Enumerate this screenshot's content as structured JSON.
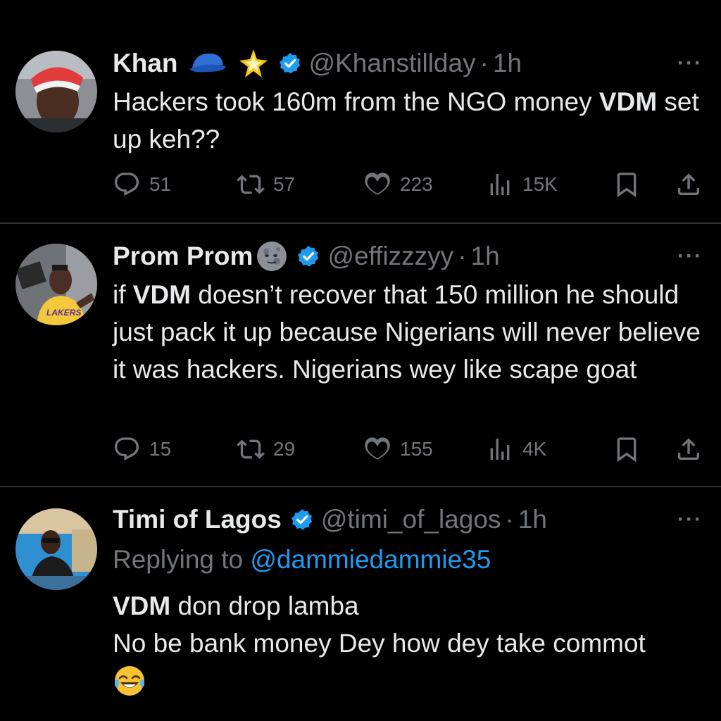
{
  "tweets": [
    {
      "name": "Khan",
      "handle": "@Khanstillday",
      "sep": "·",
      "time": "1h",
      "body_parts": [
        "Hackers took 160m from the NGO money ",
        "VDM",
        " set up keh??"
      ],
      "replies": "51",
      "retweets": "57",
      "likes": "223",
      "views": "15K"
    },
    {
      "name": "Prom Prom",
      "handle": "@effizzzyy",
      "sep": "·",
      "time": "1h",
      "body_parts": [
        "if ",
        "VDM",
        " doesn’t recover that 150 million he should just pack it up because Nigerians will never believe it was hackers. Nigerians wey like scape goat"
      ],
      "replies": "15",
      "retweets": "29",
      "likes": "155",
      "views": "4K"
    },
    {
      "name": "Timi of Lagos",
      "handle": "@timi_of_lagos",
      "sep": "·",
      "time": "1h",
      "replying_label": "Replying to ",
      "replying_handle": "@dammiedammie35",
      "line1_bold": "VDM",
      "line1_rest": " don drop lamba",
      "line2": "No be bank money Dey how dey take commot",
      "line3_emoji": "😂"
    }
  ],
  "more_label": "···",
  "colors": {
    "accent": "#1d9bf0",
    "muted": "#71767b",
    "text": "#e7e9ea",
    "background": "#000000",
    "divider": "#2f3336"
  },
  "icons": [
    "reply-icon",
    "retweet-icon",
    "like-icon",
    "views-icon",
    "bookmark-icon",
    "share-icon",
    "verified-badge-icon",
    "cap-emoji-icon",
    "sparkle-emoji-icon",
    "moon-emoji-icon",
    "more-icon"
  ]
}
